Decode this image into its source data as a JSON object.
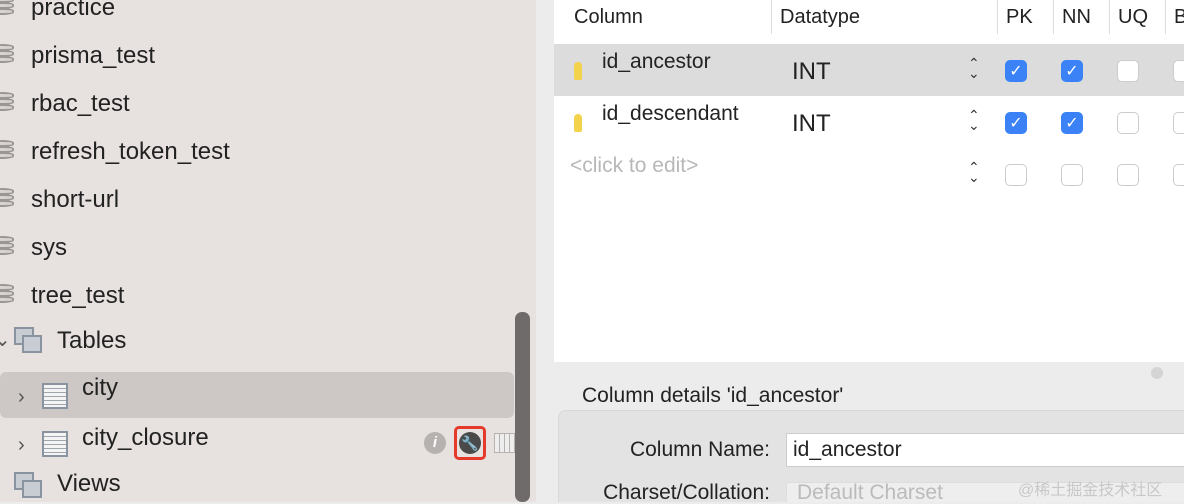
{
  "sidebar": {
    "databases": [
      "practice",
      "prisma_test",
      "rbac_test",
      "refresh_token_test",
      "short-url",
      "sys",
      "tree_test"
    ],
    "tables_group": "Tables",
    "tables": [
      "city",
      "city_closure"
    ],
    "views_group": "Views"
  },
  "table": {
    "headers": [
      "Column",
      "Datatype",
      "PK",
      "NN",
      "UQ",
      "B"
    ],
    "rows": [
      {
        "name": "id_ancestor",
        "type": "INT",
        "pk": true,
        "nn": true,
        "uq": false
      },
      {
        "name": "id_descendant",
        "type": "INT",
        "pk": true,
        "nn": true,
        "uq": false
      }
    ],
    "placeholder": "<click to edit>"
  },
  "details": {
    "title": "Column details 'id_ancestor'",
    "name_label": "Column Name:",
    "name_value": "id_ancestor",
    "charset_label": "Charset/Collation:",
    "charset_value": "Default Charset"
  },
  "watermark": "@稀土掘金技术社区",
  "highlight_color": "#e53a2a"
}
